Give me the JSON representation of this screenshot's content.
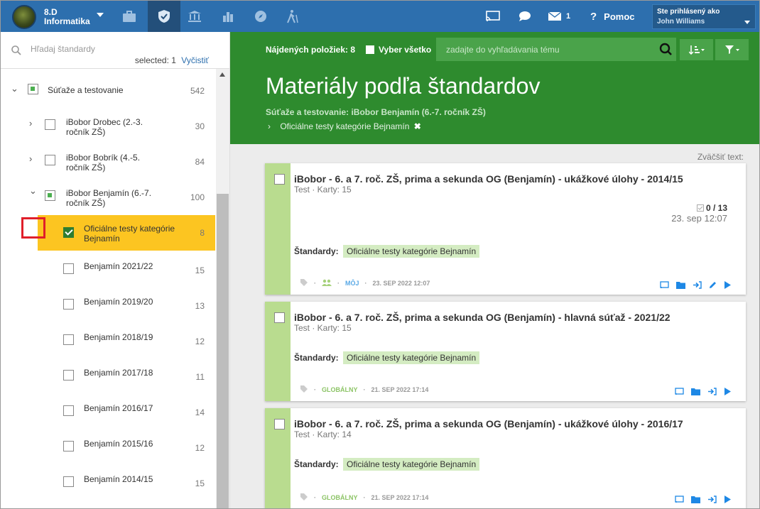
{
  "topbar": {
    "brand_line1": "8.D",
    "brand_line2": "Informatika",
    "help_label": "Pomoc",
    "messages_count": "1",
    "user_label": "Ste prihlásený ako",
    "user_name": "John Williams"
  },
  "sidebar": {
    "search_placeholder": "Hľadaj štandardy",
    "selected_label": "selected: 1",
    "clear_label": "Vyčistiť",
    "items": [
      {
        "label": "Súťaže a testovanie",
        "count": "542"
      },
      {
        "label": "iBobor Drobec (2.-3. ročník ZŠ)",
        "count": "30"
      },
      {
        "label": "iBobor Bobrík (4.-5. ročník ZŠ)",
        "count": "84"
      },
      {
        "label": "iBobor Benjamín (6.-7. ročník ZŠ)",
        "count": "100"
      },
      {
        "label": "Oficiálne testy kategórie Bejnamín",
        "count": "8"
      },
      {
        "label": "Benjamín 2021/22",
        "count": "15"
      },
      {
        "label": "Benjamín 2019/20",
        "count": "13"
      },
      {
        "label": "Benjamín 2018/19",
        "count": "12"
      },
      {
        "label": "Benjamín 2017/18",
        "count": "11"
      },
      {
        "label": "Benjamín 2016/17",
        "count": "14"
      },
      {
        "label": "Benjamín 2015/16",
        "count": "12"
      },
      {
        "label": "Benjamín 2014/15",
        "count": "15"
      }
    ]
  },
  "main": {
    "found_label": "Nájdených položiek: 8",
    "select_all_label": "Vyber všetko",
    "search_placeholder": "zadajte do vyhľadávania tému",
    "title": "Materiály podľa štandardov",
    "crumb": "Súťaže a testovanie: iBobor Benjamín (6.-7. ročník ZŠ)",
    "sub_crumb": "Oficiálne testy kategórie Bejnamín",
    "zoom_label": "Zväčšiť text:",
    "standards_label": "Štandardy:",
    "cards": [
      {
        "title": "iBobor - 6. a 7. roč. ZŠ, prima a sekunda OG (Benjamín) - ukážkové úlohy - 2014/15",
        "meta": "Test · Karty: 15",
        "score": "0 / 13",
        "date": "23. sep 12:07",
        "tag": "Oficiálne testy kategórie Bejnamín",
        "scope": "MÔJ",
        "stamp": "23. SEP 2022 12:07"
      },
      {
        "title": "iBobor - 6. a 7. roč. ZŠ, prima a sekunda OG (Benjamín) - hlavná súťaž - 2021/22",
        "meta": "Test · Karty: 15",
        "tag": "Oficiálne testy kategórie Bejnamín",
        "scope": "GLOBÁLNY",
        "stamp": "21. SEP 2022 17:14"
      },
      {
        "title": "iBobor - 6. a 7. roč. ZŠ, prima a sekunda OG (Benjamín) - ukážkové úlohy - 2016/17",
        "meta": "Test · Karty: 14",
        "tag": "Oficiálne testy kategórie Bejnamín",
        "scope": "GLOBÁLNY",
        "stamp": "21. SEP 2022 17:14"
      }
    ]
  },
  "colors": {
    "topbar": "#2d6fae",
    "hero": "#2e8b2e",
    "highlight": "#fcc521",
    "stripe": "#b9dc8f",
    "tag": "#d4ecc2",
    "annotation": "#e01f2a"
  }
}
